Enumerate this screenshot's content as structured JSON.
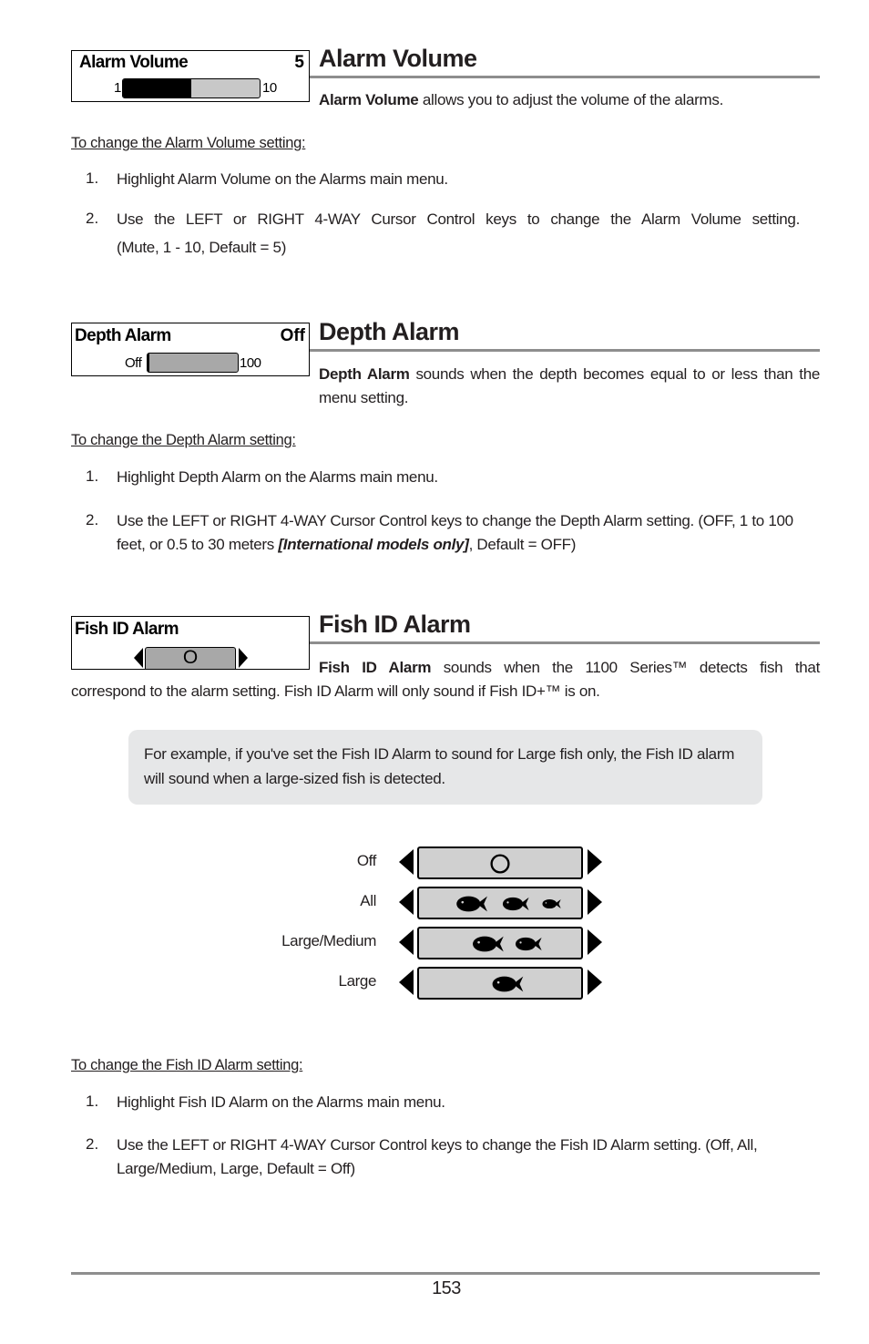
{
  "page_number": "153",
  "sections": {
    "alarm_volume": {
      "heading": "Alarm Volume",
      "widget": {
        "title": "Alarm Volume",
        "value": "5",
        "min_label": "1",
        "max_label": "10",
        "fill_fraction": 0.5
      },
      "intro_bold": "Alarm Volume",
      "intro_rest": " allows you to adjust the volume of the alarms.",
      "subheading": "To change the Alarm Volume setting:",
      "steps": [
        {
          "num": "1.",
          "text": "Highlight Alarm Volume on the Alarms main menu."
        },
        {
          "num": "2.",
          "text": "Use the LEFT or RIGHT 4-WAY Cursor Control keys to change the Alarm Volume setting.",
          "text2": "(Mute, 1 - 10, Default = 5)"
        }
      ]
    },
    "depth_alarm": {
      "heading": "Depth Alarm",
      "widget": {
        "title": "Depth Alarm",
        "value": "Off",
        "min_label": "Off",
        "max_label": "100",
        "fill_fraction": 0
      },
      "intro_bold": "Depth Alarm",
      "intro_rest": " sounds when the depth becomes equal to or less than the menu setting.",
      "subheading": "To change the Depth Alarm setting:",
      "steps": [
        {
          "num": "1.",
          "text": "Highlight Depth Alarm on the Alarms main menu."
        },
        {
          "num": "2.",
          "text": "Use the LEFT or RIGHT 4-WAY Cursor Control keys to change the Depth Alarm setting. (OFF, 1 to 100 feet, or 0.5 to 30 meters ",
          "italic": "[International models only]",
          "text_after": ", Default = OFF)"
        }
      ]
    },
    "fish_id_alarm": {
      "heading": "Fish ID Alarm",
      "widget": {
        "title": "Fish ID Alarm",
        "value": "O"
      },
      "intro_bold": "Fish ID Alarm",
      "intro_rest": " sounds when the 1100 Series™ detects fish that",
      "intro_line2": "correspond to the alarm setting. Fish ID Alarm will only sound if Fish ID+™ is on.",
      "note": "For example, if you've set the Fish ID Alarm to sound for Large fish only, the Fish ID alarm will sound when a large-sized fish is detected.",
      "options": [
        {
          "label": "Off",
          "icon": "circle-icon"
        },
        {
          "label": "All",
          "icon": "fish-large-medium-small-icon"
        },
        {
          "label": "Large/Medium",
          "icon": "fish-large-medium-icon"
        },
        {
          "label": "Large",
          "icon": "fish-large-icon"
        }
      ],
      "subheading": "To change the Fish ID Alarm setting:",
      "steps": [
        {
          "num": "1.",
          "text": "Highlight Fish ID Alarm on the Alarms main menu."
        },
        {
          "num": "2.",
          "text": "Use the LEFT or RIGHT 4-WAY Cursor Control keys to change the Fish ID Alarm setting. (Off, All, Large/Medium, Large, Default = Off)"
        }
      ]
    }
  }
}
